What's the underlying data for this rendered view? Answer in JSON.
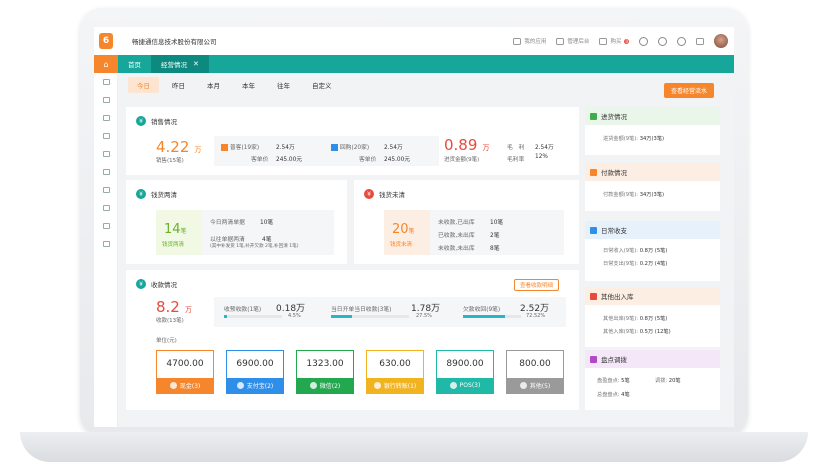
{
  "colors": {
    "accent": "#f5862b",
    "teal": "#16a69a",
    "red": "#e84b3c",
    "blue": "#27b6c8"
  },
  "header": {
    "company": "畅捷通信息技术股份有限公司",
    "my_apps": "我的应用",
    "admin": "管理后台",
    "buy": "购买",
    "badge": "0"
  },
  "tabs": [
    {
      "label": "首页"
    },
    {
      "label": "经营情况"
    }
  ],
  "filters": [
    "今日",
    "昨日",
    "本月",
    "本年",
    "往年",
    "自定义"
  ],
  "flow_button": "查看经营流水",
  "sales": {
    "title": "销售情况",
    "amount": "4.22",
    "unit": "万",
    "count": "销售(15笔)",
    "retail_label": "普客(19家)",
    "retail_amount": "2.54万",
    "retail_avg_label": "客单价",
    "retail_avg": "245.00元",
    "repeat_label": "回购(20家)",
    "repeat_amount": "2.54万",
    "repeat_avg_label": "客单价",
    "repeat_avg": "245.00元",
    "purchase_amount": "0.89",
    "purchase_unit": "万",
    "purchase_label": "进货金额(9笔)",
    "gross_label": "毛　利",
    "gross": "2.54万",
    "rate_label": "毛利率",
    "rate": "12%"
  },
  "cleared": {
    "title": "钱货两清",
    "count": "14",
    "count_unit": "笔",
    "label": "钱货两清",
    "today_label": "今日两清单据",
    "today": "10笔",
    "before_label": "以往单据两清",
    "before": "4笔",
    "note": "(其中补发货 1笔,补开欠款 2笔,补回清 1笔)"
  },
  "uncleared": {
    "title": "钱货未清",
    "count": "20",
    "count_unit": "笔",
    "label": "钱货未清",
    "r1_label": "未收款,已出库",
    "r1": "10笔",
    "r2_label": "已收款,未出库",
    "r2": "2笔",
    "r3_label": "未收款,未出库",
    "r3": "8笔"
  },
  "receipts": {
    "title": "收款情况",
    "detail_button": "查看收款明细",
    "amount": "8.2",
    "unit": "万",
    "count": "收款(13笔)",
    "items": [
      {
        "label": "收预收款(1笔)",
        "value": "0.18万",
        "pct": "4.5%",
        "pct_num": 0.045
      },
      {
        "label": "当日开单当日收款(3笔)",
        "value": "1.78万",
        "pct": "27.5%",
        "pct_num": 0.275
      },
      {
        "label": "欠款收回(9笔)",
        "value": "2.52万",
        "pct": "72.52%",
        "pct_num": 0.7252
      }
    ],
    "unit_label": "单位(元)",
    "methods": [
      {
        "amount": "4700.00",
        "label": "现金(3)",
        "color": "#f5862b"
      },
      {
        "amount": "6900.00",
        "label": "支付宝(2)",
        "color": "#2f8fe8"
      },
      {
        "amount": "1323.00",
        "label": "微信(2)",
        "color": "#23a84f"
      },
      {
        "amount": "630.00",
        "label": "银行转账(1)",
        "color": "#f2b320"
      },
      {
        "amount": "8900.00",
        "label": "POS(3)",
        "color": "#20b8a6"
      },
      {
        "amount": "800.00",
        "label": "其他(5)",
        "color": "#9a9a9a"
      }
    ]
  },
  "right": {
    "purchase": {
      "title": "进货情况",
      "l1": "进货金额(9笔):",
      "v1": "34万(3笔)",
      "bg": "#eaf6ea",
      "ic": "#3dae4a"
    },
    "payment": {
      "title": "付款情况",
      "l1": "付款金额(9笔):",
      "v1": "34万(3笔)",
      "bg": "#fdeee4",
      "ic": "#f5862b"
    },
    "daily": {
      "title": "日常收支",
      "l1": "日常收入(9笔):",
      "v1": "0.8万 (5笔)",
      "l2": "日常支出(9笔):",
      "v2": "0.2万 (4笔)",
      "bg": "#e6f1fb",
      "ic": "#2f8fe8"
    },
    "other": {
      "title": "其他出入库",
      "l1": "其他出库(9笔):",
      "v1": "0.8万 (5笔)",
      "l2": "其他入库(9笔):",
      "v2": "0.5万 (12笔)",
      "bg": "#fdeee4",
      "ic": "#e84b3c"
    },
    "stock": {
      "title": "盘点调拨",
      "l1": "盘盈盘点:",
      "v1": "5笔",
      "l1b": "调拨:",
      "v1b": "20笔",
      "l2": "总盘盘点:",
      "v2": "4笔",
      "bg": "#f4e8f8",
      "ic": "#b048c8"
    }
  }
}
